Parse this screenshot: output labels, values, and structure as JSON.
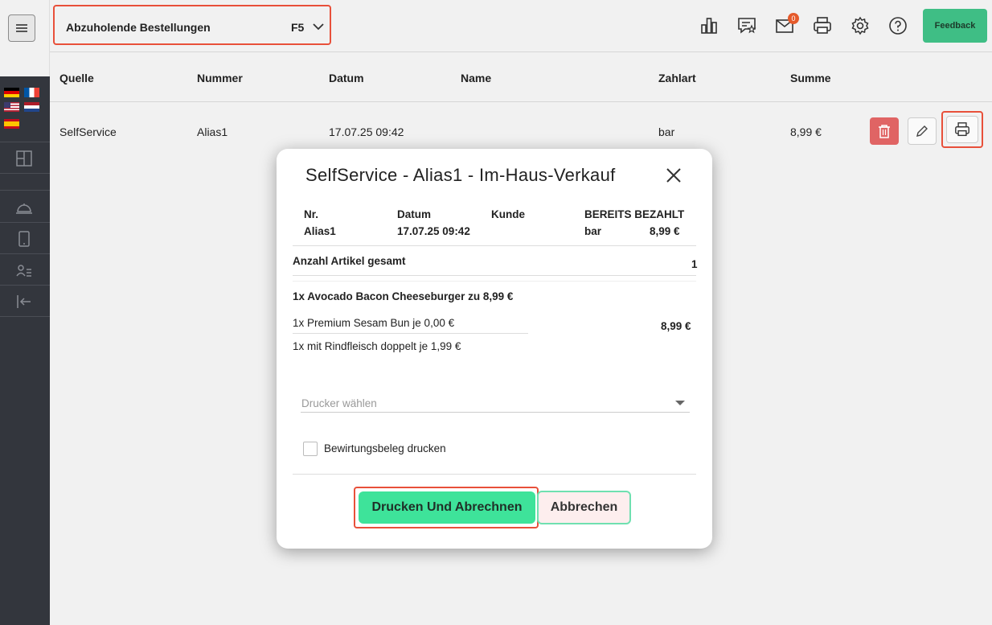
{
  "header": {
    "view_title": "Abzuholende Bestellungen",
    "view_shortcut": "F5",
    "notifications_count": "0",
    "feedback_label": "Feedback"
  },
  "table": {
    "columns": [
      "Quelle",
      "Nummer",
      "Datum",
      "Name",
      "Zahlart",
      "Summe"
    ],
    "rows": [
      {
        "quelle": "SelfService",
        "nummer": "Alias1",
        "datum": "17.07.25 09:42",
        "name": "",
        "zahlart": "bar",
        "summe": "8,99 €"
      }
    ]
  },
  "dialog": {
    "title": "SelfService - Alias1 - Im-Haus-Verkauf",
    "nr_label": "Nr.",
    "nr_value": "Alias1",
    "datum_label": "Datum",
    "datum_value": "17.07.25 09:42",
    "kunde_label": "Kunde",
    "paid_label": "BEREITS BEZAHLT",
    "paid_method": "bar",
    "paid_amount": "8,99 €",
    "article_count_label": "Anzahl Artikel gesamt",
    "article_count": "1",
    "item_title": "1x Avocado Bacon Cheeseburger zu 8,99 €",
    "item_price": "8,99 €",
    "modifiers": [
      "1x Premium Sesam Bun je 0,00 €",
      "1x mit Rindfleisch doppelt je 1,99 €"
    ],
    "printer_placeholder": "Drucker wählen",
    "receipt_checkbox_label": "Bewirtungsbeleg drucken",
    "primary_button": "Drucken Und Abrechnen",
    "cancel_button": "Abbrechen"
  },
  "colors": {
    "accent_green": "#3ee39a",
    "highlight_red": "#e8503a",
    "delete_red": "#e06464",
    "sidebar_bg": "#33363d"
  },
  "icons": [
    "menu-icon",
    "chevron-down-icon",
    "bar-chart-icon",
    "reviews-icon",
    "mail-icon",
    "printer-icon",
    "gear-icon",
    "help-icon",
    "trash-icon",
    "pencil-icon",
    "close-icon"
  ]
}
